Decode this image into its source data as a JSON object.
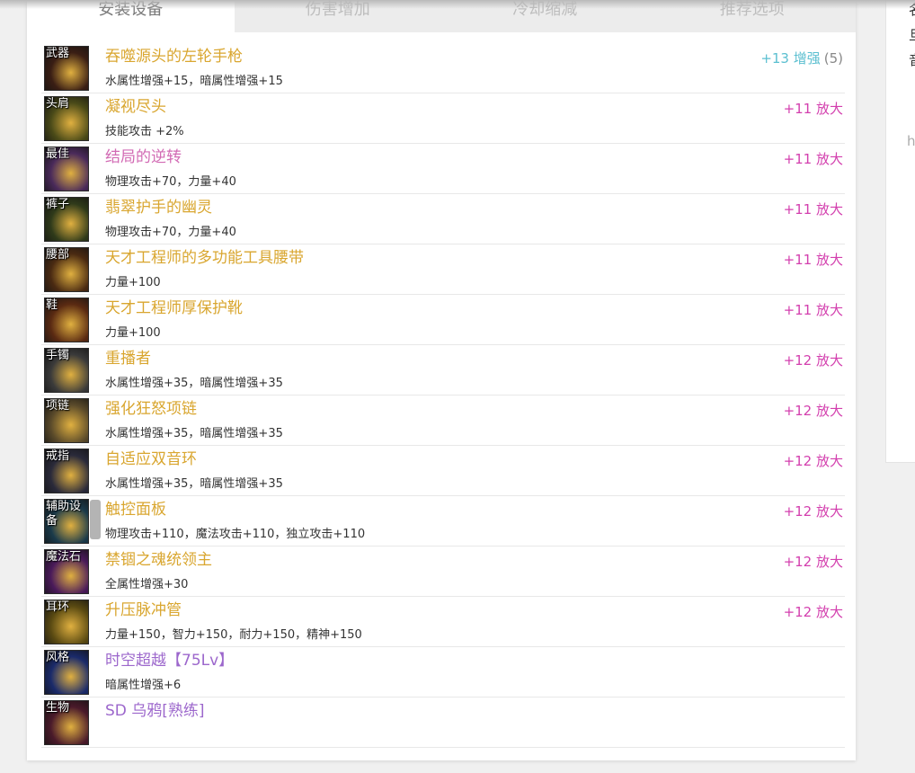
{
  "tabs": [
    {
      "label": "安装设备",
      "active": true
    },
    {
      "label": "伤害增加",
      "active": false
    },
    {
      "label": "冷却缩减",
      "active": false
    },
    {
      "label": "推荐选项",
      "active": false
    }
  ],
  "items": [
    {
      "slot": "武器",
      "name": "吞噬源头的左轮手枪",
      "name_color": "gold",
      "stat": "水属性增强+15，暗属性增强+15",
      "enhance": "+13 增强",
      "enhance_color": "blue",
      "count": "(5)",
      "icon_bg": "#3a1e14"
    },
    {
      "slot": "头肩",
      "name": "凝视尽头",
      "name_color": "gold",
      "stat": "技能攻击 +2%",
      "enhance": "+11 放大",
      "enhance_color": "magenta",
      "count": "",
      "icon_bg": "#4a4a18"
    },
    {
      "slot": "最佳",
      "name": "结局的逆转",
      "name_color": "pink",
      "stat": "物理攻击+70，力量+40",
      "enhance": "+11 放大",
      "enhance_color": "magenta",
      "count": "",
      "icon_bg": "#4a2a5a"
    },
    {
      "slot": "裤子",
      "name": "翡翠护手的幽灵",
      "name_color": "gold",
      "stat": "物理攻击+70，力量+40",
      "enhance": "+11 放大",
      "enhance_color": "magenta",
      "count": "",
      "icon_bg": "#2f3a1a"
    },
    {
      "slot": "腰部",
      "name": "天才工程师的多功能工具腰带",
      "name_color": "gold",
      "stat": "力量+100",
      "enhance": "+11 放大",
      "enhance_color": "magenta",
      "count": "",
      "icon_bg": "#4a2a12"
    },
    {
      "slot": "鞋",
      "name": "天才工程师厚保护靴",
      "name_color": "gold",
      "stat": "力量+100",
      "enhance": "+11 放大",
      "enhance_color": "magenta",
      "count": "",
      "icon_bg": "#5a2a12"
    },
    {
      "slot": "手镯",
      "name": "重播者",
      "name_color": "gold",
      "stat": "水属性增强+35，暗属性增强+35",
      "enhance": "+12 放大",
      "enhance_color": "magenta",
      "count": "",
      "icon_bg": "#3a3a3a"
    },
    {
      "slot": "项链",
      "name": "强化狂怒项链",
      "name_color": "gold",
      "stat": "水属性增强+35，暗属性增强+35",
      "enhance": "+12 放大",
      "enhance_color": "magenta",
      "count": "",
      "icon_bg": "#5a4a2a"
    },
    {
      "slot": "戒指",
      "name": "自适应双音环",
      "name_color": "gold",
      "stat": "水属性增强+35，暗属性增强+35",
      "enhance": "+12 放大",
      "enhance_color": "magenta",
      "count": "",
      "icon_bg": "#2a2a3a"
    },
    {
      "slot": "辅助设备",
      "name": "触控面板",
      "name_color": "gold",
      "stat": "物理攻击+110，魔法攻击+110，独立攻击+110",
      "enhance": "+12 放大",
      "enhance_color": "magenta",
      "count": "",
      "icon_bg": "#1a3a4a"
    },
    {
      "slot": "魔法石",
      "name": "禁锢之魂统领主",
      "name_color": "gold",
      "stat": "全属性增强+30",
      "enhance": "+12 放大",
      "enhance_color": "magenta",
      "count": "",
      "icon_bg": "#4a1a5a"
    },
    {
      "slot": "耳环",
      "name": "升压脉冲管",
      "name_color": "gold",
      "stat": "力量+150，智力+150，耐力+150，精神+150",
      "enhance": "+12 放大",
      "enhance_color": "magenta",
      "count": "",
      "icon_bg": "#5a4a12"
    },
    {
      "slot": "风格",
      "name": "时空超越【75Lv】",
      "name_color": "purple",
      "stat": "暗属性增强+6",
      "enhance": "",
      "enhance_color": "magenta",
      "count": "",
      "icon_bg": "#1a2a6a"
    },
    {
      "slot": "生物",
      "name": "SD 乌鸦[熟练]",
      "name_color": "purple",
      "stat": "",
      "enhance": "",
      "enhance_color": "magenta",
      "count": "",
      "icon_bg": "#4a1a2a"
    }
  ],
  "right_panel": {
    "chars": [
      "名",
      "旦",
      "音"
    ],
    "h_text": "h"
  }
}
